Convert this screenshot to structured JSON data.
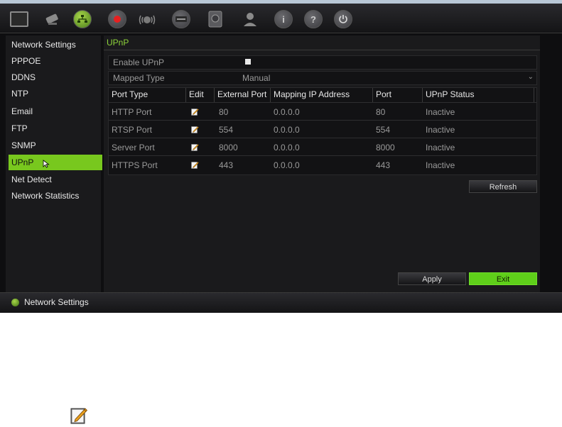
{
  "toolbar": {
    "icons": [
      "monitor-icon",
      "camera-icon",
      "network-icon",
      "record-icon",
      "alarm-icon",
      "device-icon",
      "hdd-icon",
      "user-icon",
      "info-icon",
      "help-icon",
      "power-icon"
    ],
    "active": "network-icon"
  },
  "sidebar": {
    "items": [
      {
        "label": "Network Settings"
      },
      {
        "label": "PPPOE"
      },
      {
        "label": "DDNS"
      },
      {
        "label": "NTP"
      },
      {
        "label": "Email"
      },
      {
        "label": "FTP"
      },
      {
        "label": "SNMP"
      },
      {
        "label": "UPnP"
      },
      {
        "label": "Net Detect"
      },
      {
        "label": "Network Statistics"
      }
    ],
    "active_index": 7
  },
  "main": {
    "tab_label": "UPnP",
    "enable_upnp": {
      "label": "Enable UPnP",
      "checked": true
    },
    "mapped_type": {
      "label": "Mapped Type",
      "value": "Manual"
    },
    "table": {
      "headers": [
        "Port Type",
        "Edit",
        "External Port",
        "Mapping IP Address",
        "Port",
        "UPnP Status"
      ],
      "rows": [
        {
          "port_type": "HTTP Port",
          "external_port": "80",
          "mapping_ip": "0.0.0.0",
          "port": "80",
          "status": "Inactive"
        },
        {
          "port_type": "RTSP Port",
          "external_port": "554",
          "mapping_ip": "0.0.0.0",
          "port": "554",
          "status": "Inactive"
        },
        {
          "port_type": "Server Port",
          "external_port": "8000",
          "mapping_ip": "0.0.0.0",
          "port": "8000",
          "status": "Inactive"
        },
        {
          "port_type": "HTTPS Port",
          "external_port": "443",
          "mapping_ip": "0.0.0.0",
          "port": "443",
          "status": "Inactive"
        }
      ]
    },
    "refresh_label": "Refresh",
    "apply_label": "Apply",
    "exit_label": "Exit"
  },
  "statusbar": {
    "text": "Network Settings"
  },
  "colors": {
    "accent": "#78c81e",
    "exit_button": "#5fcf1a",
    "background": "#1a1a1c"
  }
}
